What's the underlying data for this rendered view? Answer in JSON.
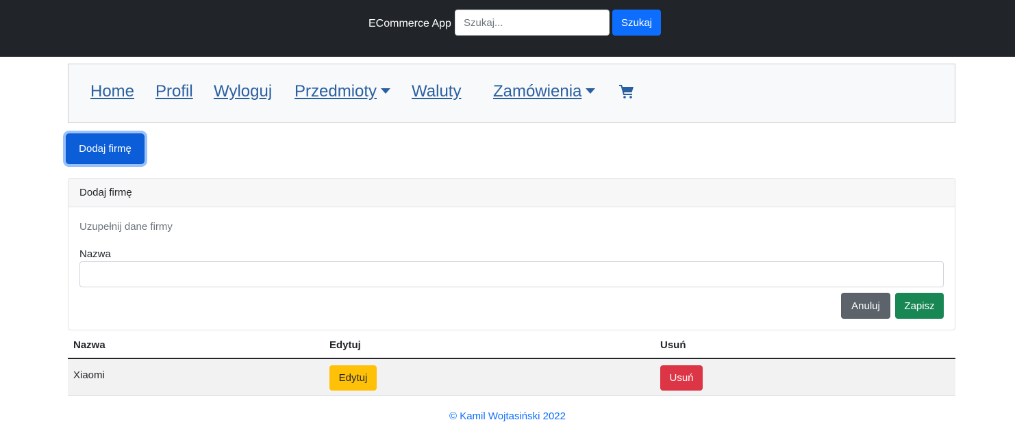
{
  "header": {
    "brand": "ECommerce App",
    "search_placeholder": "Szukaj...",
    "search_button": "Szukaj"
  },
  "nav": {
    "home": "Home",
    "profile": "Profil",
    "logout": "Wyloguj",
    "items": "Przedmioty",
    "currencies": "Waluty",
    "orders": "Zamówienia",
    "cart_icon": "shopping-cart-icon"
  },
  "actions": {
    "add_company": "Dodaj firmę"
  },
  "form": {
    "title": "Dodaj firmę",
    "subtitle": "Uzupełnij dane firmy",
    "name_label": "Nazwa",
    "name_value": "",
    "cancel": "Anuluj",
    "save": "Zapisz"
  },
  "table": {
    "headers": [
      "Nazwa",
      "Edytuj",
      "Usuń"
    ],
    "rows": [
      {
        "name": "Xiaomi",
        "edit": "Edytuj",
        "delete": "Usuń"
      }
    ]
  },
  "footer": {
    "text": "© Kamil Wojtasiński 2022"
  },
  "colors": {
    "topbar": "#212529",
    "primary": "#0d6efd",
    "success": "#198754",
    "secondary": "#5c636a",
    "warning": "#ffc107",
    "danger": "#dc3545",
    "nav_link": "#2a5fa0"
  }
}
